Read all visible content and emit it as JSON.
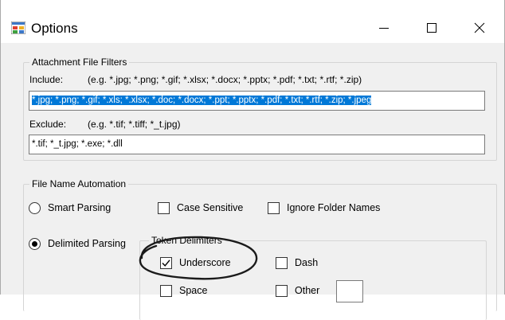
{
  "window": {
    "title": "Options"
  },
  "attachment_filters": {
    "group_title": "Attachment File Filters",
    "include_label": "Include:",
    "include_example": "(e.g. *.jpg; *.png; *.gif; *.xlsx; *.docx; *.pptx; *.pdf; *.txt; *.rtf; *.zip)",
    "include_value": "*.jpg; *.png; *.gif; *.xls; *.xlsx; *.doc; *.docx; *.ppt; *.pptx; *.pdf; *.txt; *.rtf; *.zip; *.jpeg",
    "exclude_label": "Exclude:",
    "exclude_example": "(e.g. *.tif; *.tiff; *_t.jpg)",
    "exclude_value": "*.tif; *_t.jpg; *.exe; *.dll"
  },
  "file_name_automation": {
    "group_title": "File Name Automation",
    "smart_parsing": {
      "label": "Smart Parsing",
      "selected": false
    },
    "case_sensitive": {
      "label": "Case Sensitive",
      "checked": false
    },
    "ignore_folder_names": {
      "label": "Ignore Folder Names",
      "checked": false
    },
    "delimited_parsing": {
      "label": "Delimited Parsing",
      "selected": true
    },
    "token_delimiters": {
      "group_title": "Token Delimiters",
      "underscore": {
        "label": "Underscore",
        "checked": true
      },
      "dash": {
        "label": "Dash",
        "checked": false
      },
      "space": {
        "label": "Space",
        "checked": false
      },
      "other": {
        "label": "Other",
        "checked": false,
        "value": ""
      }
    }
  },
  "annotation": {
    "shape": "ellipse",
    "color": "#1a1a1a",
    "target": "underscore-checkbox"
  },
  "colors": {
    "selection": "#0078d7",
    "window_bg": "#f0f0f0",
    "title_bg": "#ffffff"
  }
}
